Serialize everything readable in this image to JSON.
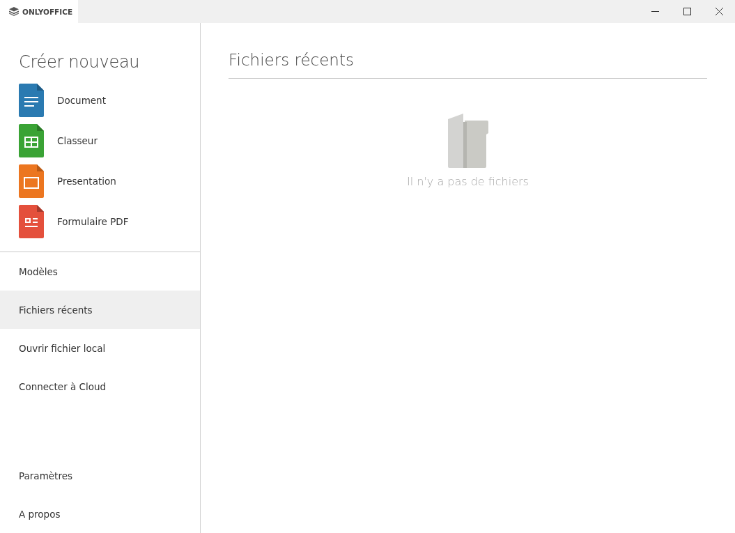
{
  "window": {
    "title": "ONLYOFFICE"
  },
  "sidebar": {
    "create_heading": "Créer nouveau",
    "create_items": [
      {
        "label": "Document",
        "kind": "document"
      },
      {
        "label": "Classeur",
        "kind": "spreadsheet"
      },
      {
        "label": "Presentation",
        "kind": "presentation"
      },
      {
        "label": "Formulaire PDF",
        "kind": "pdf-form"
      }
    ],
    "nav_items": [
      {
        "label": "Modèles",
        "selected": false
      },
      {
        "label": "Fichiers récents",
        "selected": true
      },
      {
        "label": "Ouvrir fichier local",
        "selected": false
      },
      {
        "label": "Connecter à Cloud",
        "selected": false
      }
    ],
    "bottom_items": [
      {
        "label": "Paramètres",
        "selected": false
      },
      {
        "label": "A propos",
        "selected": false
      }
    ]
  },
  "main": {
    "title": "Fichiers récents",
    "empty_message": "Il n'y a pas de fichiers"
  }
}
